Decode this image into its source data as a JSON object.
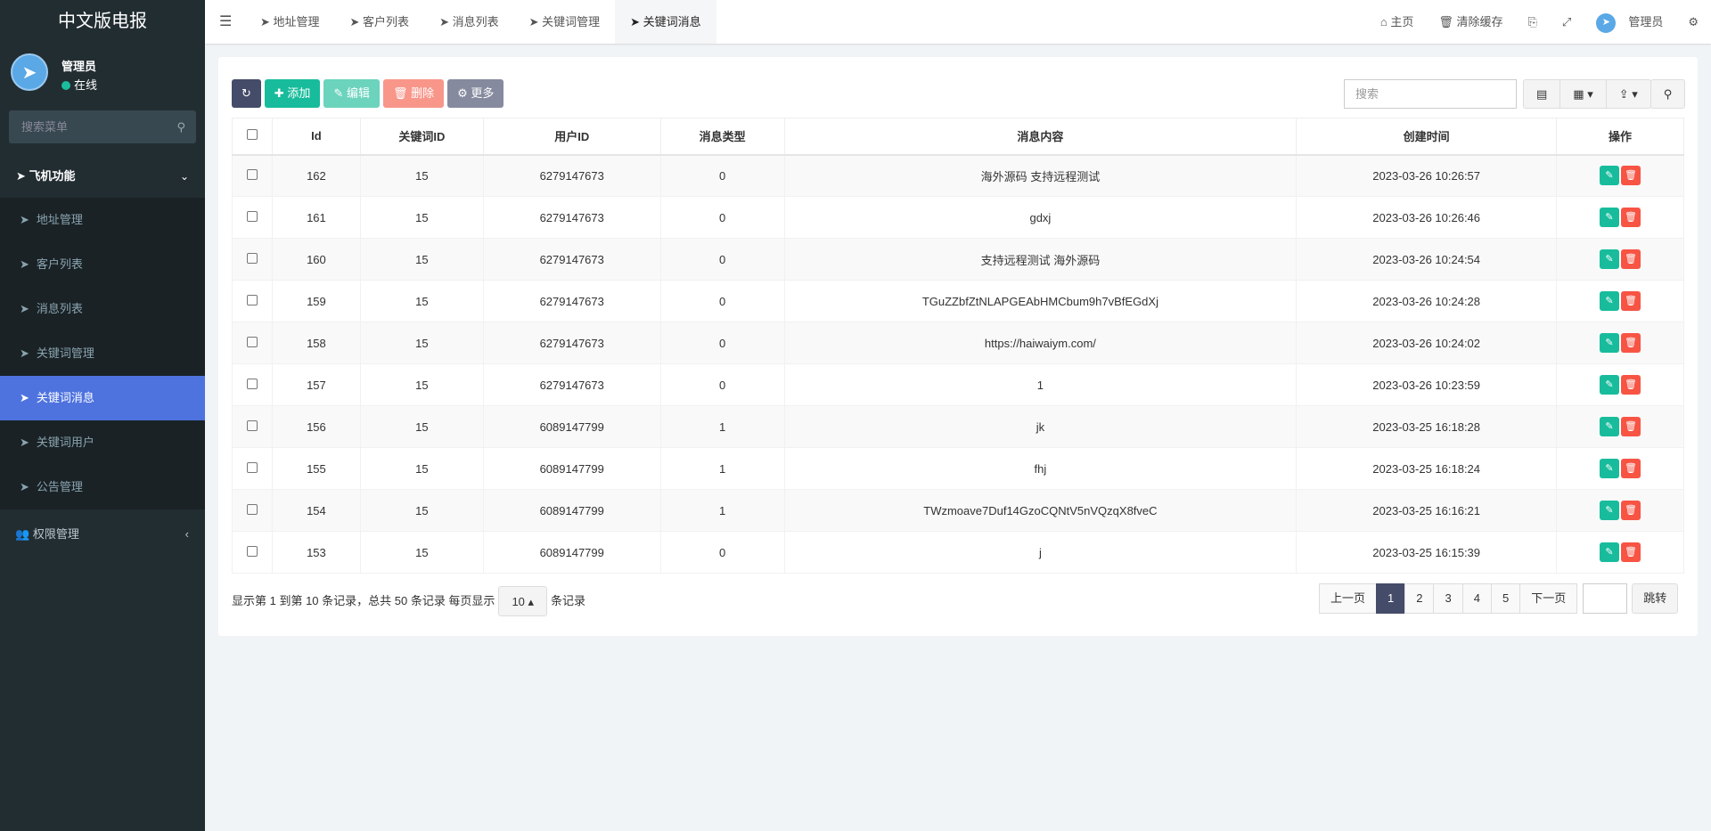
{
  "app": {
    "title": "中文版电报"
  },
  "user": {
    "name": "管理员",
    "status": "在线"
  },
  "sidebar": {
    "search_placeholder": "搜索菜单",
    "group1": "飞机功能",
    "items": [
      "地址管理",
      "客户列表",
      "消息列表",
      "关键词管理",
      "关键词消息",
      "关键词用户",
      "公告管理"
    ],
    "group2": "权限管理"
  },
  "tabs": [
    "地址管理",
    "客户列表",
    "消息列表",
    "关键词管理",
    "关键词消息"
  ],
  "topright": {
    "home": "主页",
    "clear_cache": "清除缓存",
    "user": "管理员"
  },
  "toolbar": {
    "add": "添加",
    "edit": "编辑",
    "delete": "删除",
    "more": "更多",
    "search_placeholder": "搜索"
  },
  "table": {
    "headers": [
      "Id",
      "关键词ID",
      "用户ID",
      "消息类型",
      "消息内容",
      "创建时间",
      "操作"
    ],
    "rows": [
      [
        "162",
        "15",
        "6279147673",
        "0",
        "海外源码 支持远程测试",
        "2023-03-26 10:26:57"
      ],
      [
        "161",
        "15",
        "6279147673",
        "0",
        "gdxj",
        "2023-03-26 10:26:46"
      ],
      [
        "160",
        "15",
        "6279147673",
        "0",
        "支持远程测试 海外源码",
        "2023-03-26 10:24:54"
      ],
      [
        "159",
        "15",
        "6279147673",
        "0",
        "TGuZZbfZtNLAPGEAbHMCbum9h7vBfEGdXj",
        "2023-03-26 10:24:28"
      ],
      [
        "158",
        "15",
        "6279147673",
        "0",
        "https://haiwaiym.com/",
        "2023-03-26 10:24:02"
      ],
      [
        "157",
        "15",
        "6279147673",
        "0",
        "1",
        "2023-03-26 10:23:59"
      ],
      [
        "156",
        "15",
        "6089147799",
        "1",
        "jk",
        "2023-03-25 16:18:28"
      ],
      [
        "155",
        "15",
        "6089147799",
        "1",
        "fhj",
        "2023-03-25 16:18:24"
      ],
      [
        "154",
        "15",
        "6089147799",
        "1",
        "TWzmoave7Duf14GzoCQNtV5nVQzqX8fveC",
        "2023-03-25 16:16:21"
      ],
      [
        "153",
        "15",
        "6089147799",
        "0",
        "j",
        "2023-03-25 16:15:39"
      ]
    ]
  },
  "footer": {
    "summary": "显示第 1 到第 10 条记录，总共 50 条记录 每页显示",
    "page_size": "10",
    "suffix": "条记录"
  },
  "pagination": {
    "prev": "上一页",
    "pages": [
      "1",
      "2",
      "3",
      "4",
      "5"
    ],
    "current": "1",
    "next": "下一页",
    "jump": "跳转"
  }
}
